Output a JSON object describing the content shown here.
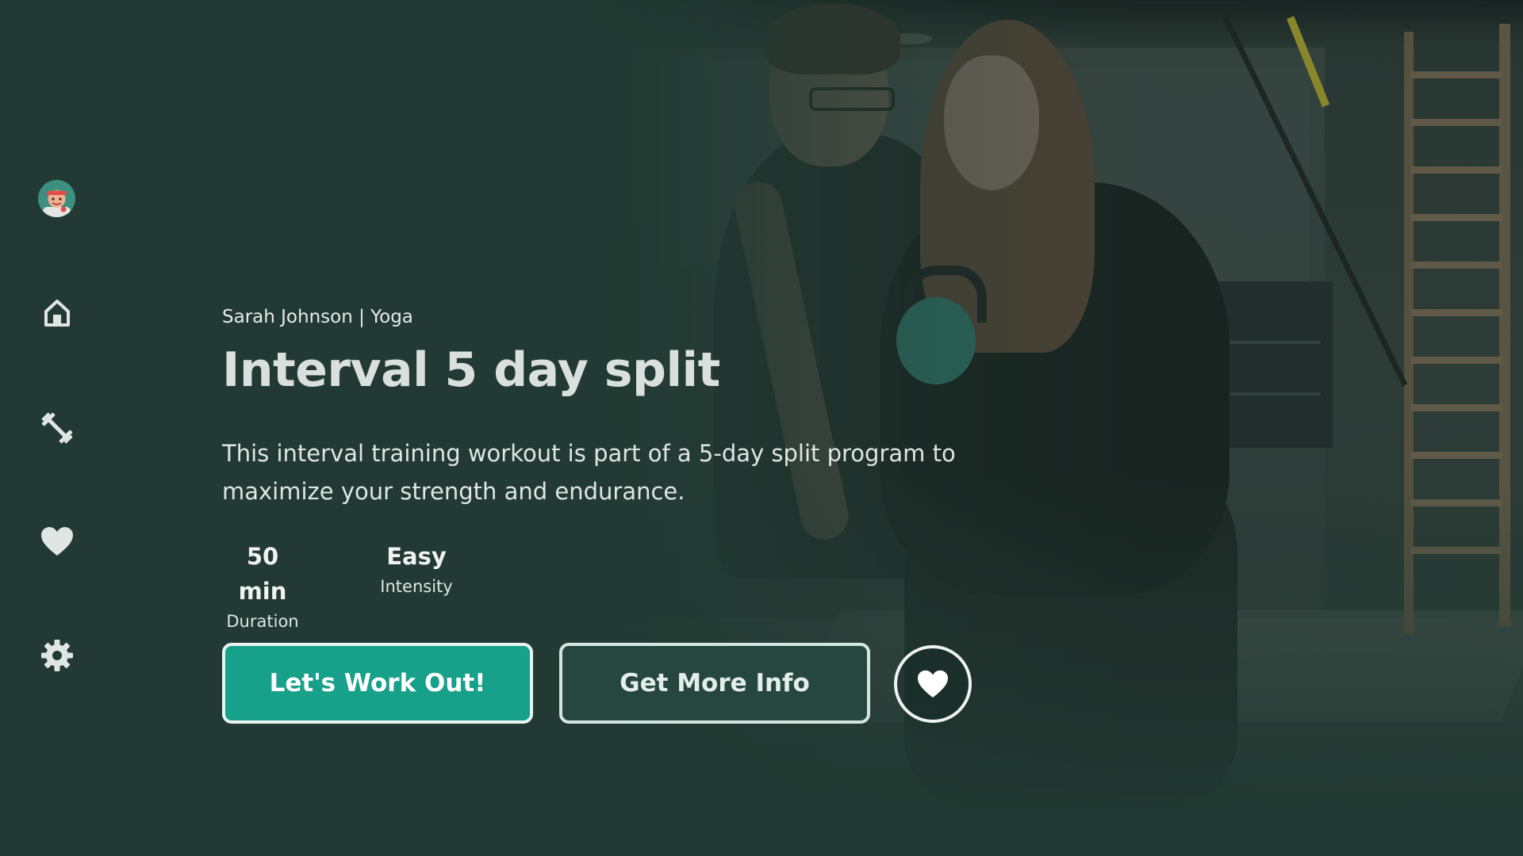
{
  "sidebar": {
    "avatar": "avatar",
    "items": [
      {
        "id": "home",
        "icon": "home-icon"
      },
      {
        "id": "workouts",
        "icon": "dumbbell-icon"
      },
      {
        "id": "favorites",
        "icon": "heart-icon"
      },
      {
        "id": "settings",
        "icon": "gear-icon"
      }
    ]
  },
  "workout": {
    "subtitle": "Sarah Johnson | Yoga",
    "title": "Interval 5 day split",
    "description": "This interval training workout is part of a 5-day split program to maximize your strength and endurance.",
    "stats": [
      {
        "value": "50 min",
        "label": "Duration"
      },
      {
        "value": "Easy",
        "label": "Intensity"
      }
    ]
  },
  "actions": {
    "primary_label": "Let's Work Out!",
    "secondary_label": "Get More Info",
    "favorite_icon": "heart-icon"
  },
  "colors": {
    "background": "#223a33",
    "accent": "#17a08a",
    "secondary_button": "#26473e",
    "text": "#dfe6e3"
  }
}
